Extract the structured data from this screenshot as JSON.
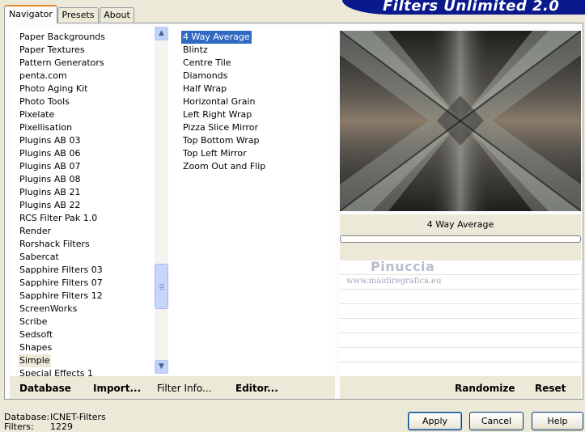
{
  "tabs": [
    "Navigator",
    "Presets",
    "About"
  ],
  "active_tab": "Navigator",
  "app_title": "Filters Unlimited 2.0",
  "categories": [
    "Paper Backgrounds",
    "Paper Textures",
    "Pattern Generators",
    "penta.com",
    "Photo Aging Kit",
    "Photo Tools",
    "Pixelate",
    "Pixellisation",
    "Plugins AB 03",
    "Plugins AB 06",
    "Plugins AB 07",
    "Plugins AB 08",
    "Plugins AB 21",
    "Plugins AB 22",
    "RCS Filter Pak 1.0",
    "Render",
    "Rorshack Filters",
    "Sabercat",
    "Sapphire Filters 03",
    "Sapphire Filters 07",
    "Sapphire Filters 12",
    "ScreenWorks",
    "Scribe",
    "Sedsoft",
    "Shapes",
    "Simple",
    "Special Effects 1"
  ],
  "selected_category": "Simple",
  "filters": [
    "4 Way Average",
    "Blintz",
    "Centre Tile",
    "Diamonds",
    "Half Wrap",
    "Horizontal Grain",
    "Left Right Wrap",
    "Pizza Slice Mirror",
    "Top Bottom Wrap",
    "Top Left Mirror",
    "Zoom Out and Flip"
  ],
  "selected_filter": "4 Way Average",
  "preview_filter_name": "4 Way Average",
  "progress": 0,
  "watermark": {
    "name": "Pinuccia",
    "url": "www.maidiregrafica.eu"
  },
  "left_bar": {
    "database": "Database",
    "import": "Import...",
    "filter_info": "Filter Info...",
    "editor": "Editor..."
  },
  "right_bar": {
    "randomize": "Randomize",
    "reset": "Reset"
  },
  "status": {
    "database_label": "Database:",
    "database_value": "ICNET-Filters",
    "filters_label": "Filters:",
    "filters_value": "1229"
  },
  "buttons": {
    "apply": "Apply",
    "cancel": "Cancel",
    "help": "Help"
  },
  "colors": {
    "selection": "#316ac5",
    "banner": "#0a1a8c",
    "tab_highlight": "#e68b2c"
  }
}
